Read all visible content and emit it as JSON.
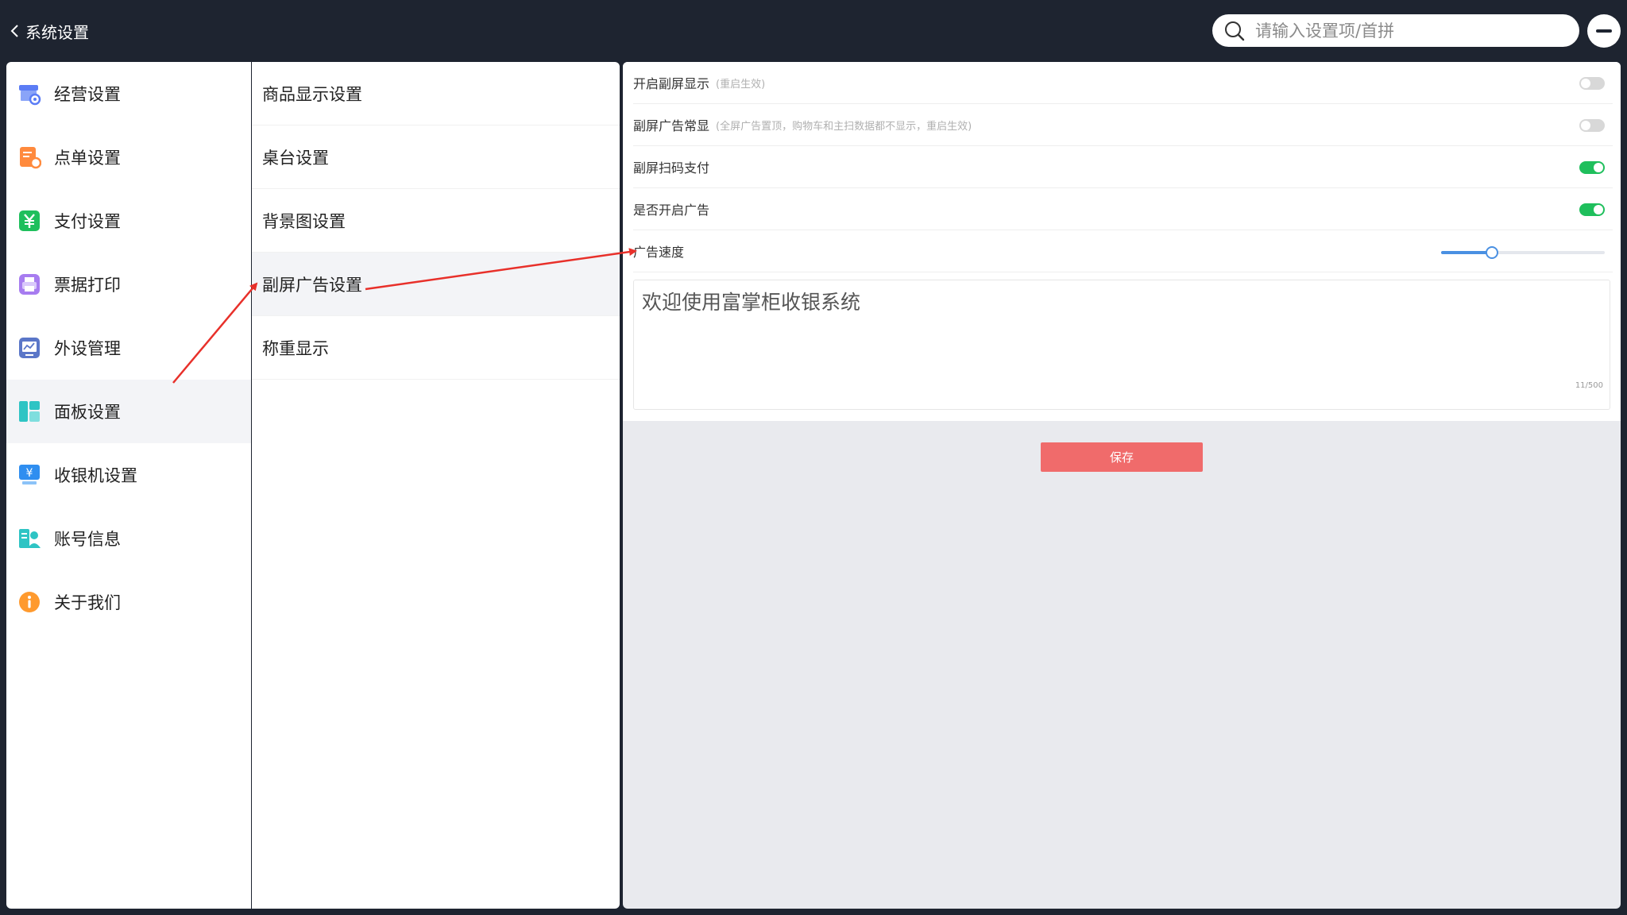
{
  "header": {
    "back_label": "系统设置",
    "search_placeholder": "请输入设置项/首拼"
  },
  "left_menu": {
    "items": [
      {
        "label": "经营设置",
        "icon": "store-settings-icon",
        "color": "#5b7cf5"
      },
      {
        "label": "点单设置",
        "icon": "order-icon",
        "color": "#ff8a3d"
      },
      {
        "label": "支付设置",
        "icon": "yuan-payment-icon",
        "color": "#1fbf5c"
      },
      {
        "label": "票据打印",
        "icon": "printer-icon",
        "color": "#a77cf0"
      },
      {
        "label": "外设管理",
        "icon": "peripheral-monitor-icon",
        "color": "#5a76c8"
      },
      {
        "label": "面板设置",
        "icon": "panel-layout-icon",
        "color": "#2ec4c4"
      },
      {
        "label": "收银机设置",
        "icon": "cash-register-icon",
        "color": "#2f8ef0"
      },
      {
        "label": "账号信息",
        "icon": "account-icon",
        "color": "#2ec4c4"
      },
      {
        "label": "关于我们",
        "icon": "info-icon",
        "color": "#ff9a2e"
      }
    ],
    "active_index": 5
  },
  "sub_menu": {
    "items": [
      "商品显示设置",
      "桌台设置",
      "背景图设置",
      "副屏广告设置",
      "称重显示"
    ],
    "active_index": 3
  },
  "settings": {
    "rows": [
      {
        "title": "开启副屏显示",
        "hint": "(重启生效)",
        "control": "toggle",
        "on": false
      },
      {
        "title": "副屏广告常显",
        "hint": "(全屏广告置顶，购物车和主扫数据都不显示，重启生效)",
        "control": "toggle",
        "on": false
      },
      {
        "title": "副屏扫码支付",
        "hint": "",
        "control": "toggle",
        "on": true
      },
      {
        "title": "是否开启广告",
        "hint": "",
        "control": "toggle",
        "on": true
      },
      {
        "title": "广告速度",
        "hint": "",
        "control": "slider",
        "value": 0.31
      }
    ],
    "ad_text": "欢迎使用富掌柜收银系统",
    "char_count": "11/500",
    "save_label": "保存"
  },
  "colors": {
    "header_bg": "#1e2430",
    "toggle_on": "#1fbf5c",
    "slider": "#4a90e2",
    "save_button": "#f06b6b",
    "annotation_arrow": "#e8302a"
  }
}
